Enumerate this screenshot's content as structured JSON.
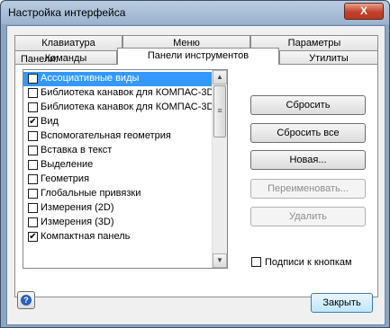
{
  "window": {
    "title": "Настройка интерфейса",
    "close_symbol": "X"
  },
  "tabs": {
    "row1": [
      {
        "label": "Клавиатура"
      },
      {
        "label": "Меню"
      },
      {
        "label": "Параметры"
      }
    ],
    "row2": [
      {
        "label": "Команды"
      },
      {
        "label": "Панели инструментов"
      },
      {
        "label": "Утилиты"
      }
    ],
    "active": "Панели инструментов"
  },
  "panels": {
    "label": "Панели:",
    "items": [
      {
        "label": "Ассоциативные виды",
        "checked": false,
        "selected": true
      },
      {
        "label": "Библиотека канавок для КОМПАС-3D",
        "checked": false,
        "selected": false
      },
      {
        "label": "Библиотека канавок для КОМПАС-3D",
        "checked": false,
        "selected": false
      },
      {
        "label": "Вид",
        "checked": true,
        "selected": false
      },
      {
        "label": "Вспомогательная геометрия",
        "checked": false,
        "selected": false
      },
      {
        "label": "Вставка в текст",
        "checked": false,
        "selected": false
      },
      {
        "label": "Выделение",
        "checked": false,
        "selected": false
      },
      {
        "label": "Геометрия",
        "checked": false,
        "selected": false
      },
      {
        "label": "Глобальные привязки",
        "checked": false,
        "selected": false
      },
      {
        "label": "Измерения (2D)",
        "checked": false,
        "selected": false
      },
      {
        "label": "Измерения (3D)",
        "checked": false,
        "selected": false
      },
      {
        "label": "Компактная панель",
        "checked": true,
        "selected": false
      }
    ]
  },
  "buttons": {
    "reset": "Сбросить",
    "reset_all": "Сбросить все",
    "new": "Новая...",
    "rename": "Переименовать...",
    "delete": "Удалить"
  },
  "captions_checkbox": {
    "label": "Подписи к кнопкам",
    "checked": false
  },
  "footer": {
    "help_symbol": "?",
    "close_label": "Закрыть"
  }
}
